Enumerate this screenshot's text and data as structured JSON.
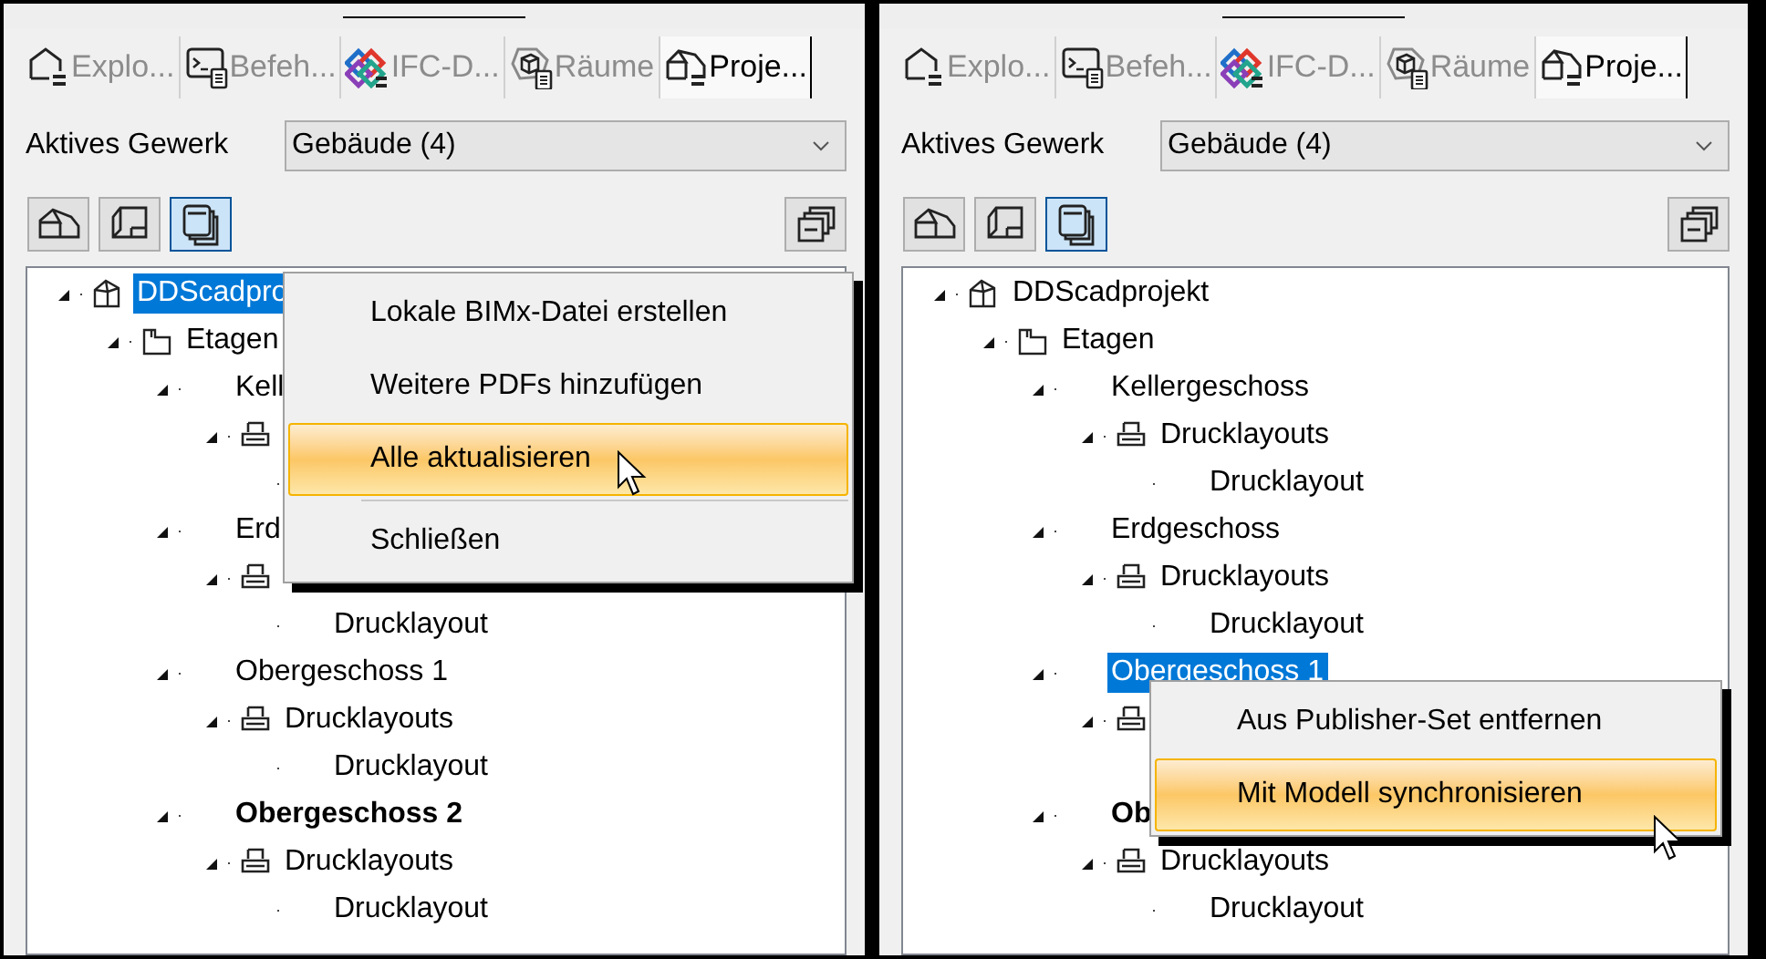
{
  "panels": [
    {
      "tabs": [
        {
          "kind": "explorer",
          "label": "Explo...",
          "selected": false
        },
        {
          "kind": "command",
          "label": "Befeh...",
          "selected": false
        },
        {
          "kind": "ifc",
          "label": "IFC-D...",
          "selected": false
        },
        {
          "kind": "rooms",
          "label": "Räume",
          "selected": false
        },
        {
          "kind": "project",
          "label": "Proje...",
          "selected": true
        }
      ],
      "filter": {
        "label": "Aktives Gewerk",
        "value": "Gebäude (4)"
      },
      "toolbar": [
        {
          "kind": "building",
          "selected": false
        },
        {
          "kind": "plan",
          "selected": false
        },
        {
          "kind": "sheets",
          "selected": true
        }
      ],
      "tree": [
        {
          "kind": "project",
          "label": "DDScadpro",
          "selected": true,
          "expanded": true,
          "children": [
            {
              "kind": "folder",
              "label": "Etagen",
              "selected": false,
              "expanded": true,
              "children": [
                {
                  "label": "Kell",
                  "selected": false,
                  "current": false,
                  "expanded": true,
                  "children": [
                    {
                      "kind": "layouts",
                      "expanded": true
                    }
                  ]
                },
                {
                  "label": "Erd",
                  "selected": false,
                  "current": false,
                  "expanded": true,
                  "children": [
                    {
                      "kind": "layouts",
                      "expanded": true,
                      "children": [
                        {
                          "label": "Drucklayout",
                          "selected": false
                        }
                      ]
                    }
                  ]
                },
                {
                  "label": "Obergeschoss 1",
                  "selected": false,
                  "current": false,
                  "expanded": true,
                  "children": [
                    {
                      "kind": "layouts",
                      "label": "Drucklayouts",
                      "selected": false,
                      "expanded": true,
                      "children": [
                        {
                          "label": "Drucklayout",
                          "selected": false
                        }
                      ]
                    }
                  ]
                },
                {
                  "label": "Obergeschoss 2",
                  "selected": false,
                  "current": true,
                  "expanded": true,
                  "children": [
                    {
                      "kind": "layouts",
                      "label": "Drucklayouts",
                      "selected": false,
                      "expanded": true,
                      "children": [
                        {
                          "label": "Drucklayout",
                          "selected": false
                        }
                      ]
                    }
                  ]
                }
              ]
            }
          ]
        }
      ],
      "context_menu": {
        "items": [
          {
            "kind": "item",
            "label": "Lokale BIMx-Datei erstellen",
            "selected": false
          },
          {
            "kind": "item",
            "label": "Weitere PDFs hinzufügen",
            "selected": false
          },
          {
            "kind": "item",
            "label": "Alle aktualisieren",
            "selected": true
          },
          {
            "kind": "separator"
          },
          {
            "kind": "item",
            "label": "Schließen",
            "selected": false
          }
        ]
      }
    },
    {
      "tabs": [
        {
          "kind": "explorer",
          "label": "Explo...",
          "selected": false
        },
        {
          "kind": "command",
          "label": "Befeh...",
          "selected": false
        },
        {
          "kind": "ifc",
          "label": "IFC-D...",
          "selected": false
        },
        {
          "kind": "rooms",
          "label": "Räume",
          "selected": false
        },
        {
          "kind": "project",
          "label": "Proje...",
          "selected": true
        }
      ],
      "filter": {
        "label": "Aktives Gewerk",
        "value": "Gebäude (4)"
      },
      "toolbar": [
        {
          "kind": "building",
          "selected": false
        },
        {
          "kind": "plan",
          "selected": false
        },
        {
          "kind": "sheets",
          "selected": true
        }
      ],
      "tree": [
        {
          "kind": "project",
          "label": "DDScadprojekt",
          "selected": false,
          "expanded": true,
          "children": [
            {
              "kind": "folder",
              "label": "Etagen",
              "selected": false,
              "expanded": true,
              "children": [
                {
                  "label": "Kellergeschoss",
                  "selected": false,
                  "current": false,
                  "expanded": true,
                  "children": [
                    {
                      "kind": "layouts",
                      "label": "Drucklayouts",
                      "selected": false,
                      "expanded": true,
                      "children": [
                        {
                          "label": "Drucklayout",
                          "selected": false
                        }
                      ]
                    }
                  ]
                },
                {
                  "label": "Erdgeschoss",
                  "selected": false,
                  "current": false,
                  "expanded": true,
                  "children": [
                    {
                      "kind": "layouts",
                      "label": "Drucklayouts",
                      "selected": false,
                      "expanded": true,
                      "children": [
                        {
                          "label": "Drucklayout",
                          "selected": false
                        }
                      ]
                    }
                  ]
                },
                {
                  "label": "Obergeschoss 1",
                  "selected": true,
                  "current": false,
                  "expanded": true,
                  "children": [
                    {
                      "kind": "layouts",
                      "expanded": true
                    }
                  ]
                },
                {
                  "label": "Ob",
                  "selected": false,
                  "current": true,
                  "expanded": true,
                  "children": [
                    {
                      "kind": "layouts",
                      "label": "Drucklayouts",
                      "selected": false,
                      "expanded": true,
                      "children": [
                        {
                          "label": "Drucklayout",
                          "selected": false
                        }
                      ]
                    }
                  ]
                }
              ]
            }
          ]
        }
      ],
      "context_menu": {
        "items": [
          {
            "kind": "item",
            "label": "Aus Publisher-Set entfernen",
            "selected": false
          },
          {
            "kind": "item",
            "label": "Mit Modell synchronisieren",
            "selected": true
          }
        ]
      }
    }
  ]
}
